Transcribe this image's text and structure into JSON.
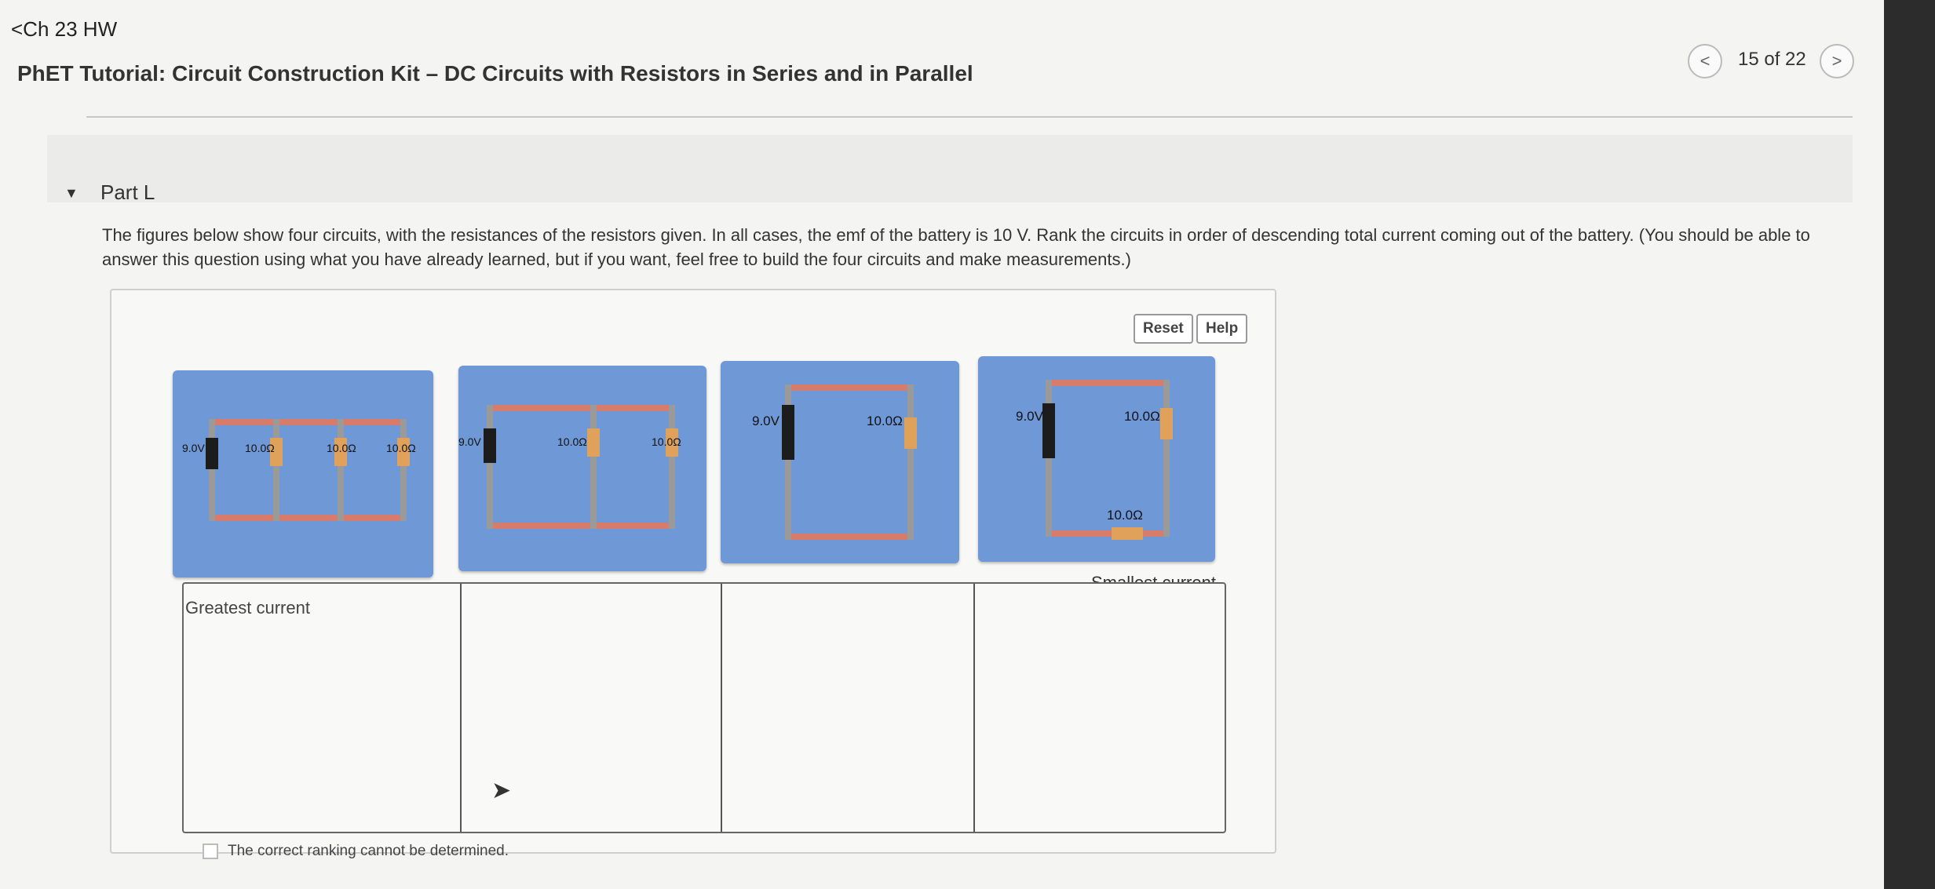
{
  "header": {
    "back_label": "<Ch 23 HW",
    "title": "PhET Tutorial: Circuit Construction Kit – DC Circuits with Resistors in Series and in Parallel",
    "nav_prev": "<",
    "nav_next": ">",
    "nav_count": "15 of 22"
  },
  "part": {
    "label": "Part L"
  },
  "question": {
    "text": "The figures below show four circuits, with the resistances of the resistors given. In all cases, the emf of the battery is 10 V. Rank the circuits in order of descending total current coming out of the battery. (You should be able to answer this question using what you have already learned, but if you want, feel free to build the four circuits and make measurements.)"
  },
  "toolbar": {
    "reset_label": "Reset",
    "help_label": "Help"
  },
  "circuits": [
    {
      "battery": "9.0V",
      "resistors": [
        "10.0Ω",
        "10.0Ω",
        "10.0Ω"
      ]
    },
    {
      "battery": "9.0V",
      "resistors": [
        "10.0Ω",
        "10.0Ω"
      ]
    },
    {
      "battery": "9.0V",
      "resistors": [
        "10.0Ω"
      ]
    },
    {
      "battery": "9.0V",
      "resistors": [
        "10.0Ω",
        "10.0Ω"
      ]
    }
  ],
  "ranking": {
    "greatest_label": "Greatest current",
    "smallest_label": "Smallest current",
    "cannot_label": "The correct ranking cannot be determined."
  },
  "colors": {
    "card_bg": "#6f98d7",
    "wire": "#d77b6b",
    "battery": "#1c1c1c"
  }
}
